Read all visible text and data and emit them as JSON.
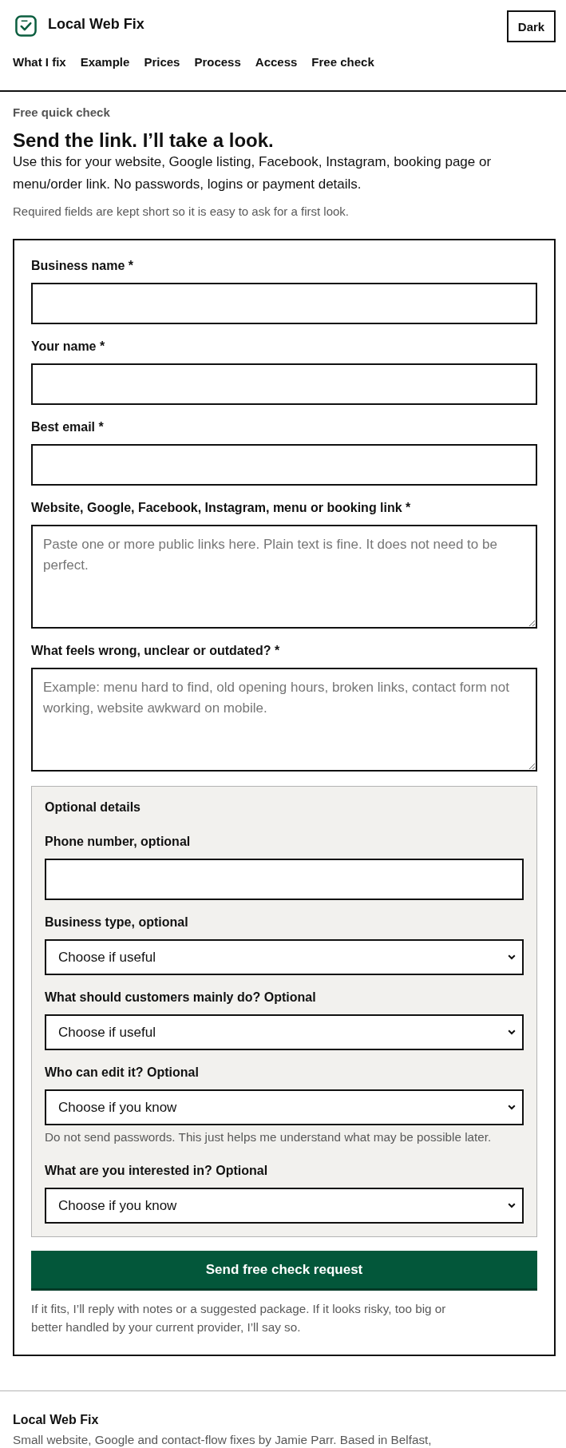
{
  "header": {
    "brand": "Local Web Fix",
    "theme_button": "Dark",
    "nav": [
      "What I fix",
      "Example",
      "Prices",
      "Process",
      "Access",
      "Free check"
    ]
  },
  "intro": {
    "eyebrow": "Free quick check",
    "title": "Send the link. I’ll take a look.",
    "lead": "Use this for your website, Google listing, Facebook, Instagram, booking page or menu/order link. No passwords, logins or payment details.",
    "note": "Required fields are kept short so it is easy to ask for a first look."
  },
  "form": {
    "fields": [
      {
        "kind": "input",
        "label": "Business name *"
      },
      {
        "kind": "input",
        "label": "Your name *"
      },
      {
        "kind": "input",
        "label": "Best email *"
      },
      {
        "kind": "textarea",
        "label": "Website, Google, Facebook, Instagram, menu or booking link *",
        "placeholder": "Paste one or more public links here. Plain text is fine. It does not need to be perfect."
      },
      {
        "kind": "textarea",
        "label": "What feels wrong, unclear or outdated? *",
        "placeholder": "Example: menu hard to find, old opening hours, broken links, contact form not working, website awkward on mobile."
      }
    ],
    "optional": {
      "title": "Optional details",
      "fields": [
        {
          "kind": "input",
          "label": "Phone number, optional"
        },
        {
          "kind": "select",
          "label": "Business type, optional",
          "value": "Choose if useful"
        },
        {
          "kind": "select",
          "label": "What should customers mainly do? Optional",
          "value": "Choose if useful"
        },
        {
          "kind": "select",
          "label": "Who can edit it? Optional",
          "value": "Choose if you know",
          "hint": "Do not send passwords. This just helps me understand what may be possible later."
        },
        {
          "kind": "select",
          "label": "What are you interested in? Optional",
          "value": "Choose if you know"
        }
      ]
    },
    "submit": "Send free check request",
    "footnote": "If it fits, I’ll reply with notes or a suggested package. If it looks risky, too big or better handled by your current provider, I’ll say so."
  },
  "footer": {
    "brand": "Local Web Fix",
    "text": "Small website, Google and contact-flow fixes by Jamie Parr. Based in Belfast,"
  }
}
